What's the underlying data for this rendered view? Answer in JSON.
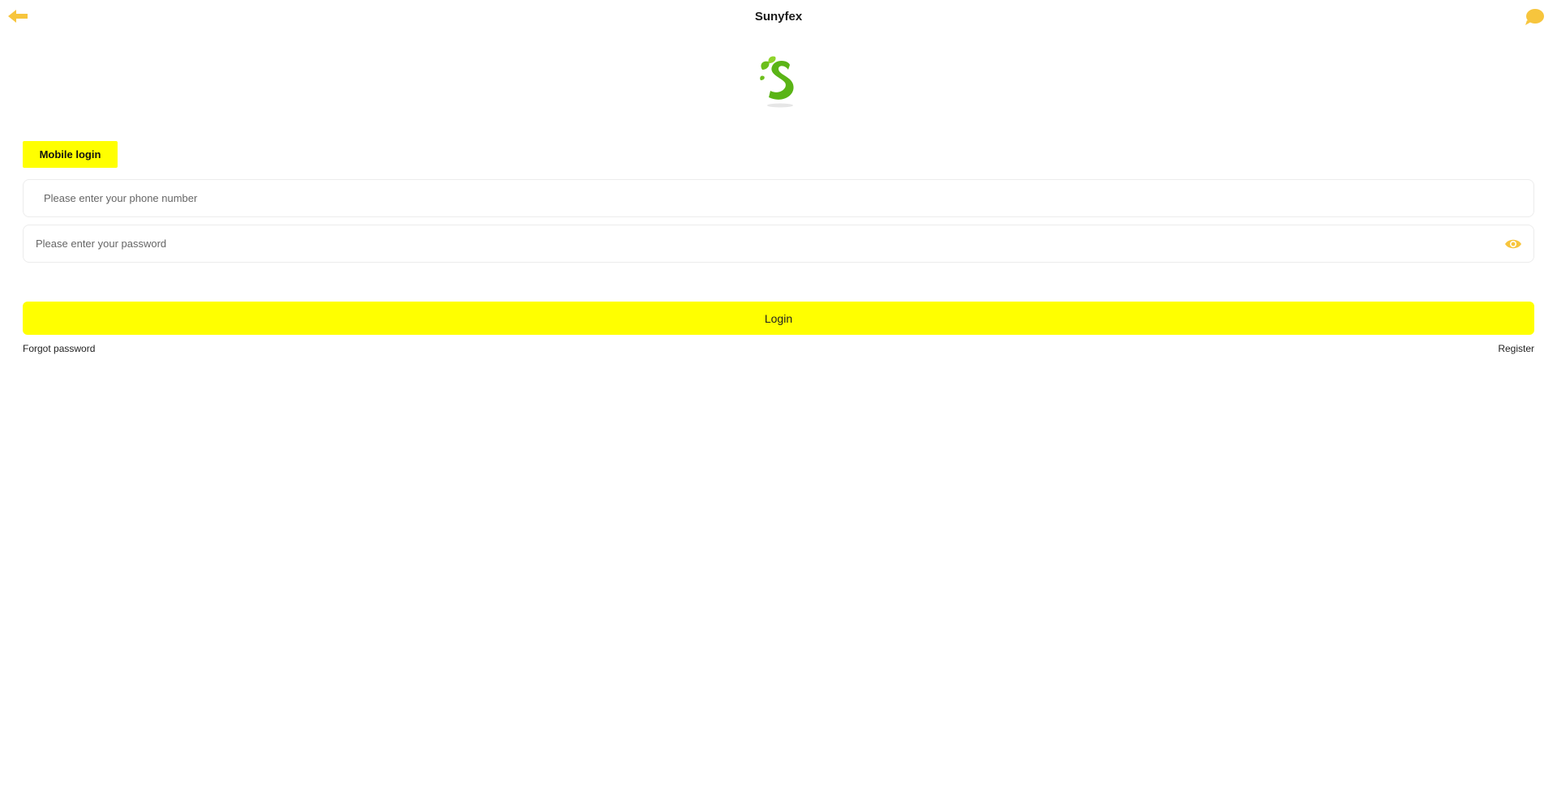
{
  "header": {
    "title": "Sunyfex",
    "back_icon": "arrow-left-icon",
    "chat_icon": "chat-bubble-icon"
  },
  "logo": {
    "icon": "leaf-s-logo"
  },
  "tabs": {
    "mobile_login": "Mobile login"
  },
  "form": {
    "phone_placeholder": "Please enter your phone number",
    "phone_value": "",
    "password_placeholder": "Please enter your password",
    "password_value": "",
    "eye_icon": "eye-icon"
  },
  "actions": {
    "login_label": "Login",
    "forgot_password_label": "Forgot password",
    "register_label": "Register"
  },
  "colors": {
    "accent": "#ffff00",
    "icon_accent": "#f7c53d",
    "logo_green": "#6cbf1c"
  }
}
